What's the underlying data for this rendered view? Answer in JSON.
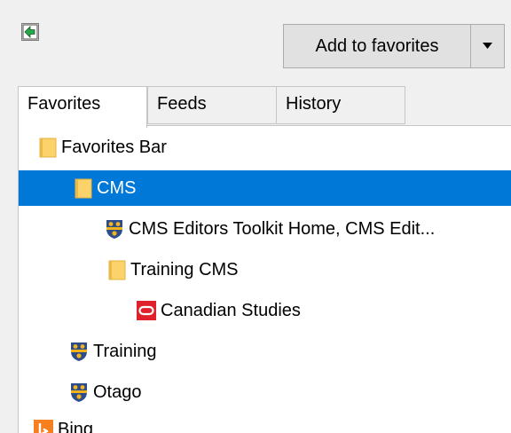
{
  "toolbar": {
    "pin_icon": "green-arrow-pin-icon",
    "add_to_favorites_label": "Add to favorites",
    "dropdown_icon": "caret-down-icon"
  },
  "tabs": [
    {
      "label": "Favorites",
      "active": true
    },
    {
      "label": "Feeds",
      "active": false
    },
    {
      "label": "History",
      "active": false
    }
  ],
  "tree": [
    {
      "label": "Favorites Bar",
      "icon": "folder-icon",
      "selected": false
    },
    {
      "label": "CMS",
      "icon": "folder-icon",
      "selected": true
    },
    {
      "label": "CMS Editors Toolkit Home, CMS Edit...",
      "icon": "university-crest-icon",
      "selected": false
    },
    {
      "label": "Training CMS",
      "icon": "folder-icon",
      "selected": false
    },
    {
      "label": "Canadian Studies",
      "icon": "red-o-logo-icon",
      "selected": false
    },
    {
      "label": "Training",
      "icon": "university-crest-icon",
      "selected": false
    },
    {
      "label": "Otago",
      "icon": "university-crest-icon",
      "selected": false
    },
    {
      "label": "Bing",
      "icon": "bing-icon",
      "selected": false
    }
  ],
  "colors": {
    "selection": "#0078d7",
    "folder": "#fcd26b",
    "crest_blue": "#2c4c8c",
    "crest_gold": "#f2b21a",
    "oracle_red": "#e0202a",
    "bing_orange": "#f6801f"
  }
}
